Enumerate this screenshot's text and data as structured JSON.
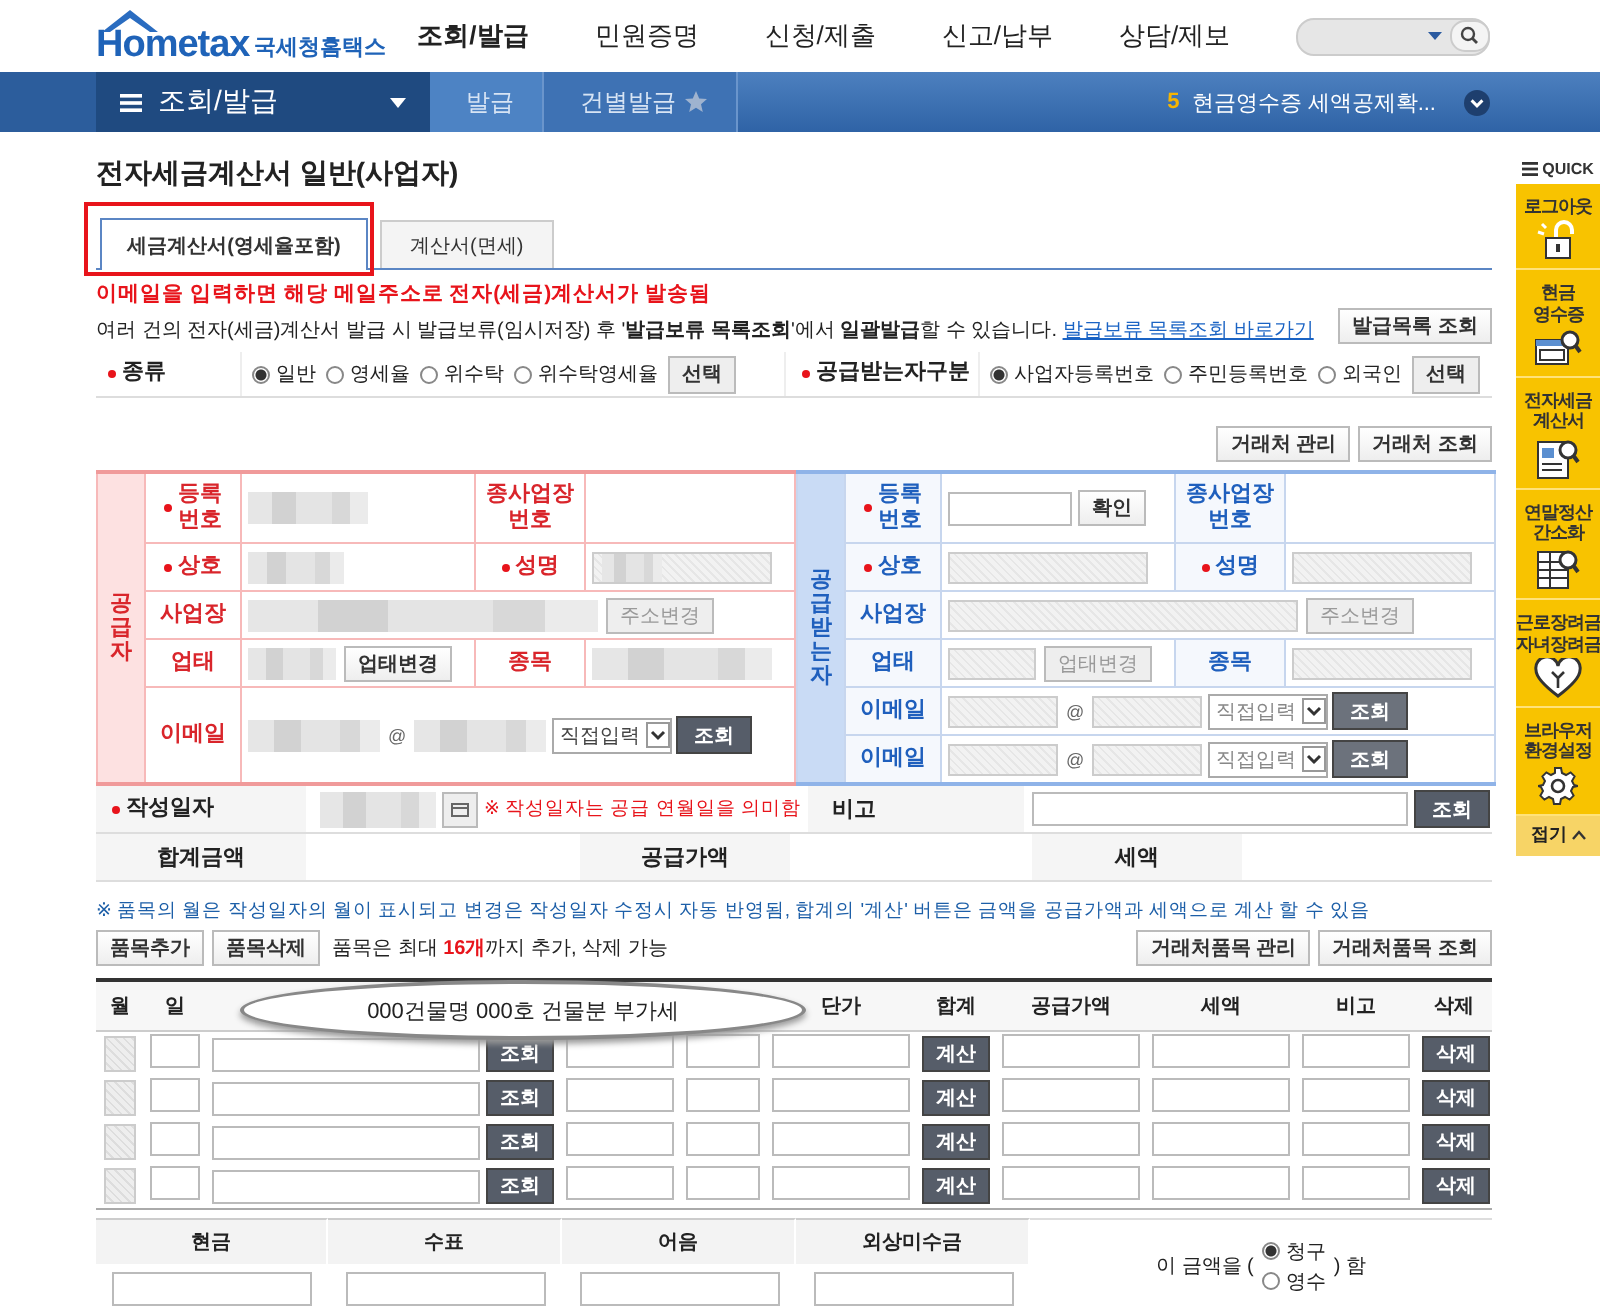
{
  "header": {
    "logo": "Hometax",
    "logo_subtitle": "국세청홈택스",
    "nav": [
      {
        "label": "조회/발급",
        "selected": true
      },
      {
        "label": "민원증명",
        "selected": false
      },
      {
        "label": "신청/제출",
        "selected": false
      },
      {
        "label": "신고/납부",
        "selected": false
      },
      {
        "label": "상담/제보",
        "selected": false
      }
    ]
  },
  "subnav": {
    "menu": "조회/발급",
    "breadcrumbs": [
      "발급",
      "건별발급"
    ],
    "notice_count": "5",
    "notice": "현금영수증 세액공제확..."
  },
  "page": {
    "title": "전자세금계산서 일반(사업자)",
    "tabs": [
      {
        "label": "세금계산서(영세율포함)",
        "selected": true,
        "highlighted": true
      },
      {
        "label": "계산서(면세)",
        "selected": false,
        "highlighted": false
      }
    ],
    "email_notice": "이메일을 입력하면 해당 메일주소로 전자(세금)계산서가 발송됨",
    "info": "여러 건의 전자(세금)계산서 발급 시 발급보류(임시저장) 후 '**발급보류 목록조회**'에서 **일괄발급**할 수 있습니다.",
    "info_link": "발급보류 목록조회 바로가기",
    "list_button": "발급목록 조회"
  },
  "type_row": {
    "label": {
      "text": "종류",
      "required": true
    },
    "options": [
      {
        "label": "일반",
        "selected": true
      },
      {
        "label": "영세율",
        "selected": false
      },
      {
        "label": "위수탁",
        "selected": false
      },
      {
        "label": "위수탁영세율",
        "selected": false
      }
    ],
    "button": "선택"
  },
  "receiver_type": {
    "label": {
      "text": "공급받는자구분",
      "required": true
    },
    "options": [
      {
        "label": "사업자등록번호",
        "selected": true
      },
      {
        "label": "주민등록번호",
        "selected": false
      },
      {
        "label": "외국인",
        "selected": false
      }
    ],
    "button": "선택"
  },
  "client_buttons": [
    "거래처 관리",
    "거래처 조회"
  ],
  "supplier": {
    "title": "공급자",
    "reg_label": {
      "text": "등록 번호",
      "required": true
    },
    "sub_label": {
      "text": "종사업장 번호",
      "required": false
    },
    "name_label": {
      "text": "상호",
      "required": true
    },
    "rep_label": {
      "text": "성명",
      "required": true
    },
    "address_label": {
      "text": "사업장",
      "required": false
    },
    "address_button": {
      "label": "주소변경",
      "disabled": true
    },
    "biztype_label": {
      "text": "업태",
      "required": false
    },
    "biztype_button": {
      "label": "업태변경",
      "disabled": false
    },
    "item_label": {
      "text": "종목",
      "required": false
    },
    "emails": [
      {
        "label": "이메일",
        "at": "@",
        "select": "직접입력",
        "button": "조회"
      }
    ]
  },
  "receiver": {
    "title": "공급받는자",
    "reg_label": {
      "text": "등록 번호",
      "required": true
    },
    "confirm_button": "확인",
    "sub_label": {
      "text": "종사업장 번호",
      "required": false
    },
    "name_label": {
      "text": "상호",
      "required": true
    },
    "rep_label": {
      "text": "성명",
      "required": true
    },
    "address_label": {
      "text": "사업장",
      "required": false
    },
    "address_button": {
      "label": "주소변경",
      "disabled": true
    },
    "biztype_label": {
      "text": "업태",
      "required": false
    },
    "biztype_button": {
      "label": "업태변경",
      "disabled": true
    },
    "item_label": {
      "text": "종목",
      "required": false
    },
    "emails": [
      {
        "label": "이메일",
        "at": "@",
        "select": "직접입력",
        "button": "조회"
      },
      {
        "label": "이메일",
        "at": "@",
        "select": "직접입력",
        "button": "조회"
      }
    ]
  },
  "date_row": {
    "label": {
      "text": "작성일자",
      "required": true
    },
    "note": "※ 작성일자는 공급 연월일을 의미함",
    "remark_label": "비고",
    "remark_button": "조회"
  },
  "totals": [
    "합계금액",
    "공급가액",
    "세액"
  ],
  "items": {
    "note": "※ 품목의 월은 작성일자의 월이 표시되고 변경은 작성일자 수정시 자동 반영됨, 합계의 '계산' 버튼은 금액을 공급가액과 세액으로 계산 할 수 있음",
    "add_button": "품목추가",
    "delete_button": "품목삭제",
    "limit_text": "품목은 최대 **16개**까지 추가, 삭제 가능",
    "manage_button": "거래처품목 관리",
    "lookup_button": "거래처품목 조회",
    "columns": [
      "월",
      "일",
      "단가",
      "합계",
      "공급가액",
      "세액",
      "비고",
      "삭제"
    ],
    "tooltip": "000건물명 000호 건물분 부가세",
    "rows": [
      {
        "checked": false,
        "lookup": "조회",
        "calc": "계산",
        "delete": "삭제"
      },
      {
        "checked": false,
        "lookup": "조회",
        "calc": "계산",
        "delete": "삭제"
      },
      {
        "checked": false,
        "lookup": "조회",
        "calc": "계산",
        "delete": "삭제"
      },
      {
        "checked": false,
        "lookup": "조회",
        "calc": "계산",
        "delete": "삭제"
      }
    ]
  },
  "payment": {
    "columns": [
      "현금",
      "수표",
      "어음",
      "외상미수금"
    ],
    "claim_prefix": "이 금액을 (",
    "claim_options": [
      {
        "label": "청구",
        "selected": true
      },
      {
        "label": "영수",
        "selected": false
      }
    ],
    "claim_suffix": ") 함"
  },
  "quick": {
    "title": "QUICK",
    "items": [
      "로그아웃",
      "현금 영수증",
      "전자세금 계산서",
      "연말정산 간소화",
      "근로장려금 자녀장려금",
      "브라우저 환경설정"
    ],
    "fold": "접기"
  }
}
